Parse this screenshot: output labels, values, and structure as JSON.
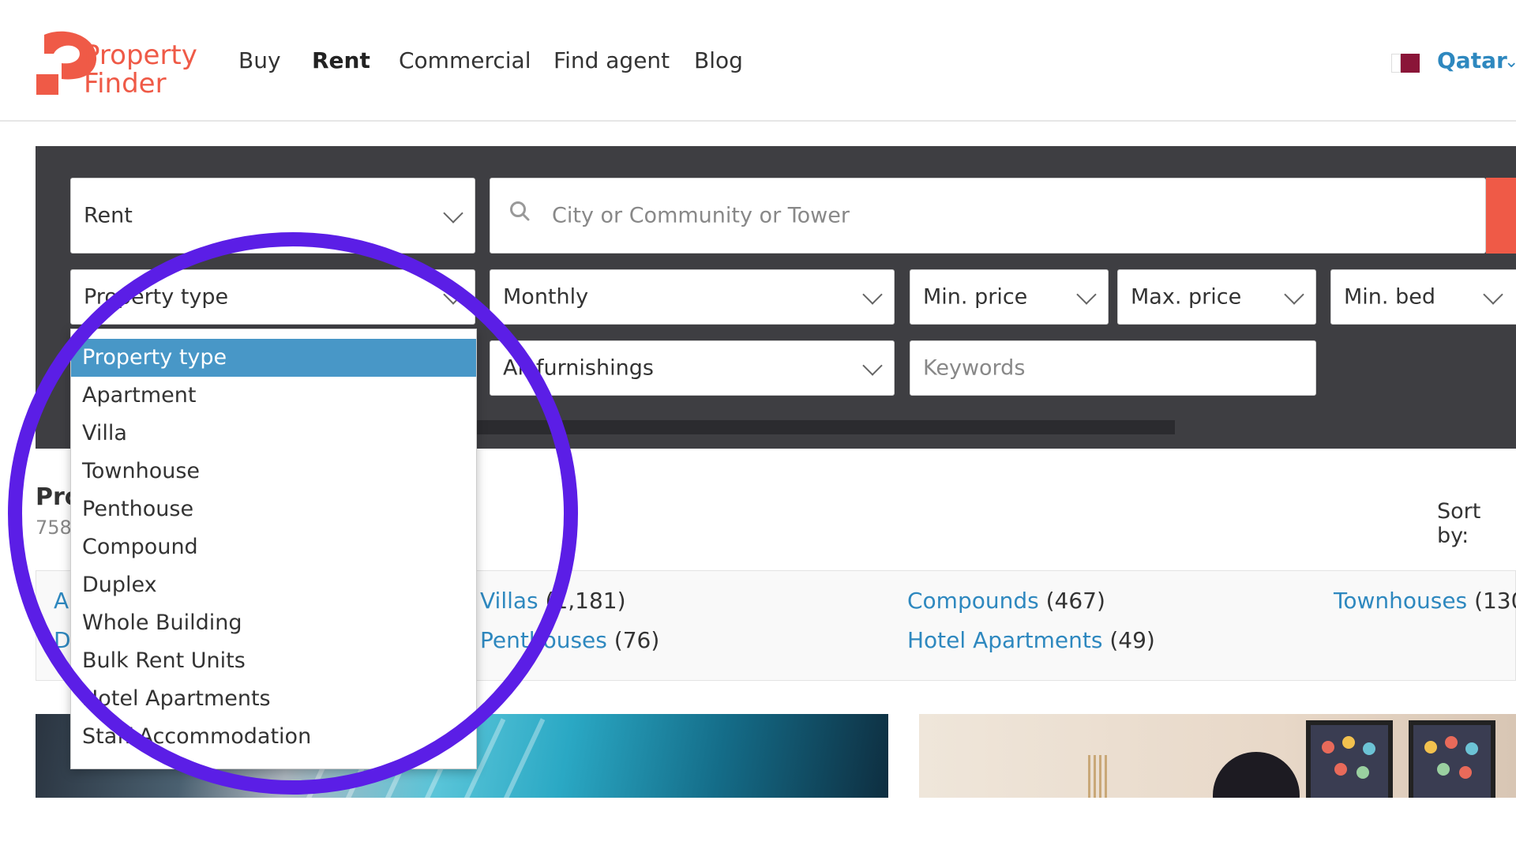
{
  "brand": {
    "line1": "Property",
    "line2": "Finder",
    "color": "#ef5a47"
  },
  "nav": {
    "items": [
      "Buy",
      "Rent",
      "Commercial",
      "Find agent",
      "Blog"
    ],
    "active": "Rent"
  },
  "country": {
    "label": "Qatar",
    "flag_icon": "qatar-flag-icon"
  },
  "search": {
    "category": "Rent",
    "location_placeholder": "City or Community or Tower",
    "property_type": "Property type",
    "rent_frequency": "Monthly",
    "min_price": "Min. price",
    "max_price": "Max. price",
    "min_bed": "Min. bed",
    "furnishings": "All furnishings",
    "keywords_placeholder": "Keywords"
  },
  "dropdown": {
    "options": [
      "Property type",
      "Apartment",
      "Villa",
      "Townhouse",
      "Penthouse",
      "Compound",
      "Duplex",
      "Whole Building",
      "Bulk Rent Units",
      "Hotel Apartments",
      "Staff Accommodation"
    ],
    "selected": "Property type"
  },
  "results": {
    "title": "Pro",
    "count": "758",
    "sort_label": "Sort by:",
    "categories": [
      {
        "name": "A",
        "count": ""
      },
      {
        "name": "D",
        "count": ""
      },
      {
        "name": "Villas",
        "count": "(1,181)"
      },
      {
        "name": "Penthouses",
        "count": "(76)"
      },
      {
        "name": "Compounds",
        "count": "(467)"
      },
      {
        "name": "Hotel Apartments",
        "count": "(49)"
      },
      {
        "name": "Townhouses",
        "count": "(130"
      }
    ]
  },
  "colors": {
    "panel": "#3e3e42",
    "selected": "#4897c7",
    "link": "#2e88bf",
    "annotation": "#5b1ee6"
  }
}
